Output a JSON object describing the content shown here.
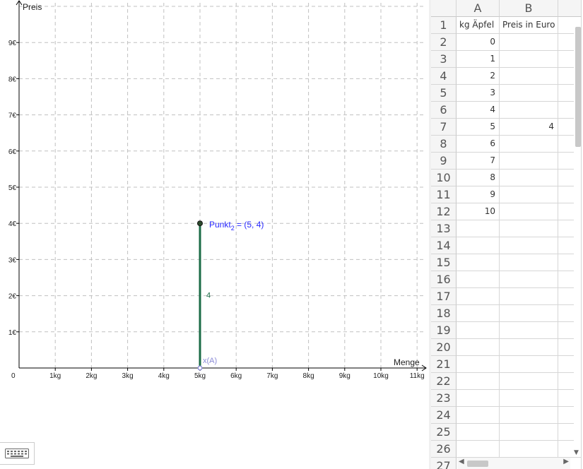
{
  "graphics": {
    "y_axis_label": "Preis",
    "x_axis_label": "Menge",
    "origin_label": "0",
    "x_ticks": [
      "1kg",
      "2kg",
      "3kg",
      "4kg",
      "5kg",
      "6kg",
      "7kg",
      "8kg",
      "9kg",
      "10kg",
      "11kg"
    ],
    "y_ticks": [
      "1€",
      "2€",
      "3€",
      "4€",
      "5€",
      "6€",
      "7€",
      "8€",
      "9€"
    ],
    "point_name": "Punkt",
    "point_subscript": "2",
    "point_coords": " = (5, 4)",
    "point": {
      "x": 5,
      "y": 4
    },
    "segment_label": "4",
    "foot_label": "x(A)",
    "colors": {
      "segment": "#1b6b46",
      "point_label": "#2a2aff",
      "foot": "#8a8ad6",
      "grid": "#c0c0c0"
    }
  },
  "spreadsheet": {
    "columns": [
      "A",
      "B"
    ],
    "rows": [
      {
        "n": "1",
        "a": "kg Äpfel",
        "b": "Preis in Euro"
      },
      {
        "n": "2",
        "a": "0",
        "b": ""
      },
      {
        "n": "3",
        "a": "1",
        "b": ""
      },
      {
        "n": "4",
        "a": "2",
        "b": ""
      },
      {
        "n": "5",
        "a": "3",
        "b": ""
      },
      {
        "n": "6",
        "a": "4",
        "b": ""
      },
      {
        "n": "7",
        "a": "5",
        "b": "4"
      },
      {
        "n": "8",
        "a": "6",
        "b": ""
      },
      {
        "n": "9",
        "a": "7",
        "b": ""
      },
      {
        "n": "10",
        "a": "8",
        "b": ""
      },
      {
        "n": "11",
        "a": "9",
        "b": ""
      },
      {
        "n": "12",
        "a": "10",
        "b": ""
      },
      {
        "n": "13",
        "a": "",
        "b": ""
      },
      {
        "n": "14",
        "a": "",
        "b": ""
      },
      {
        "n": "15",
        "a": "",
        "b": ""
      },
      {
        "n": "16",
        "a": "",
        "b": ""
      },
      {
        "n": "17",
        "a": "",
        "b": ""
      },
      {
        "n": "18",
        "a": "",
        "b": ""
      },
      {
        "n": "19",
        "a": "",
        "b": ""
      },
      {
        "n": "20",
        "a": "",
        "b": ""
      },
      {
        "n": "21",
        "a": "",
        "b": ""
      },
      {
        "n": "22",
        "a": "",
        "b": ""
      },
      {
        "n": "23",
        "a": "",
        "b": ""
      },
      {
        "n": "24",
        "a": "",
        "b": ""
      },
      {
        "n": "25",
        "a": "",
        "b": ""
      },
      {
        "n": "26",
        "a": "",
        "b": ""
      },
      {
        "n": "27",
        "a": "",
        "b": ""
      }
    ]
  },
  "icons": {
    "keyboard": "keyboard-icon",
    "scroll_down": "▼",
    "scroll_left": "◀",
    "scroll_right": "▶"
  }
}
